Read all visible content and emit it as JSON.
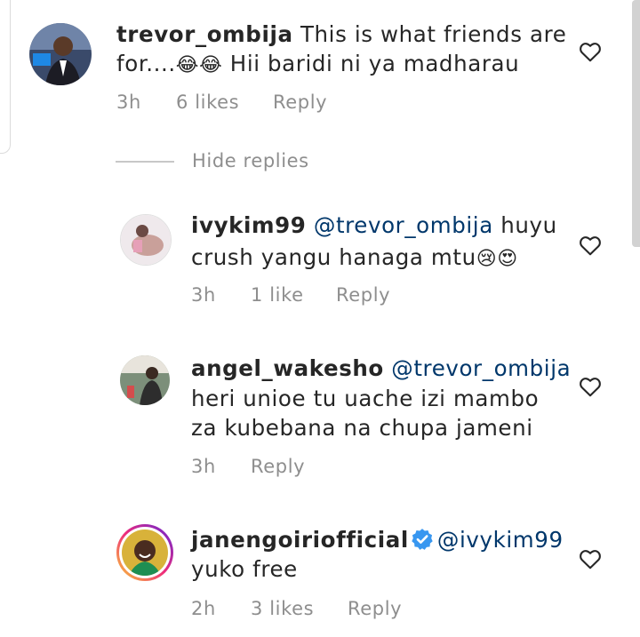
{
  "comments": [
    {
      "username": "trevor_ombija",
      "mention": "",
      "line1": "This is what friends are",
      "line2": "for....",
      "emoji": "😂😂",
      "line2b": " Hii baridi ni ya madharau",
      "time": "3h",
      "likes": "6 likes",
      "reply": "Reply"
    }
  ],
  "hide_replies": "Hide replies",
  "replies": [
    {
      "username": "ivykim99",
      "mention": "@trevor_ombija",
      "line1_rest": " huyu",
      "line2": "crush yangu hanaga mtu",
      "emoji": "😢😍",
      "time": "3h",
      "likes": "1 like",
      "reply": "Reply"
    },
    {
      "username": "angel_wakesho",
      "mention": "@trevor_ombija",
      "line2": "heri unioe tu uache izi mambo",
      "line3": "za kubebana na chupa jameni",
      "time": "3h",
      "reply": "Reply"
    },
    {
      "username": "janengoiriofficial",
      "mention": "@ivykim99",
      "line2": "yuko free",
      "time": "2h",
      "likes": "3 likes",
      "reply": "Reply"
    }
  ],
  "colors": {
    "text": "#262626",
    "mention": "#00376b",
    "meta": "#8e8e8e",
    "verified": "#3897f0"
  },
  "icons": [
    "heart-outline-icon",
    "verified-badge-icon"
  ]
}
